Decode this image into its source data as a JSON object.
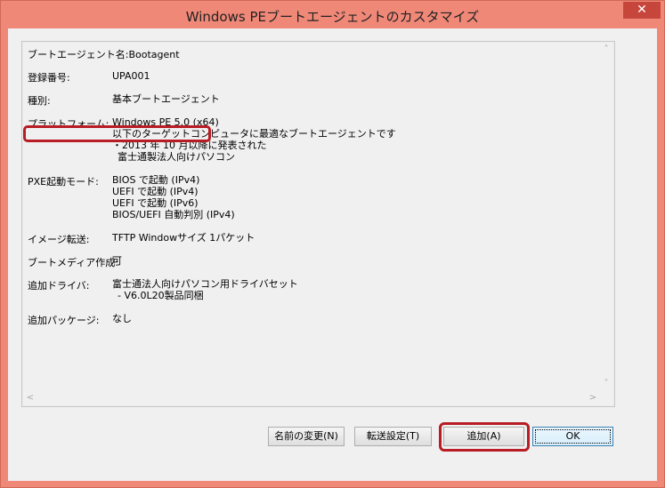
{
  "window": {
    "title": "Windows PEブートエージェントのカスタマイズ",
    "close_glyph": "✕"
  },
  "details": {
    "agent_name": "ブートエージェント名:Bootagent",
    "reg_number_label": "登録番号:",
    "reg_number_value": "UPA001",
    "type_label": "種別:",
    "type_value": "基本ブートエージェント",
    "platform_label": "プラットフォーム:",
    "platform_value": "Windows PE 5.0 (x64)",
    "platform_desc_1": "以下のターゲットコンピュータに最適なブートエージェントです",
    "platform_desc_2": "・2013 年 10 月以降に発表された",
    "platform_desc_3": "富士通製法人向けパソコン",
    "pxe_label": "PXE起動モード:",
    "pxe_values": [
      "BIOS で起動 (IPv4)",
      "UEFI で起動 (IPv4)",
      "UEFI で起動 (IPv6)",
      "BIOS/UEFI 自動判別 (IPv4)"
    ],
    "image_transfer_label": "イメージ転送:",
    "image_transfer_value": "TFTP Windowサイズ 1パケット",
    "boot_media_label": "ブートメディア作成:",
    "boot_media_value": "可",
    "driver_label": "追加ドライバ:",
    "driver_value_1": "富士通法人向けパソコン用ドライバセット",
    "driver_value_2": "- V6.0L20製品同梱",
    "package_label": "追加パッケージ:",
    "package_value": "なし"
  },
  "scroll": {
    "up": "˄",
    "down": "˅",
    "left": "<",
    "right": ">"
  },
  "buttons": {
    "rename": "名前の変更(N)",
    "transfer_settings": "転送設定(T)",
    "add": "追加(A)",
    "ok": "OK"
  },
  "colors": {
    "title_bar": "#f08878",
    "close_button": "#c7463c",
    "highlight_border": "#b81c24"
  }
}
